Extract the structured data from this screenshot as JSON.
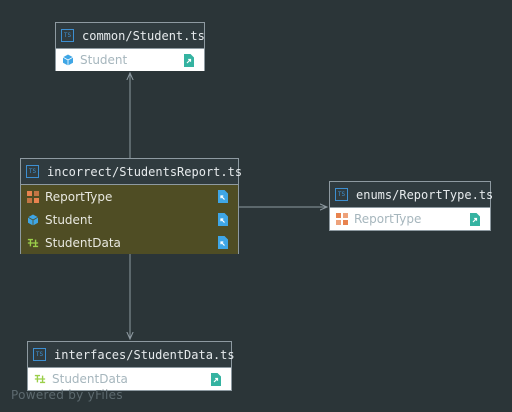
{
  "nodes": {
    "common_student": {
      "title": "common/Student.ts",
      "items": [
        {
          "label": "Student",
          "icon": "cube-icon"
        }
      ]
    },
    "incorrect_students_report": {
      "title": "incorrect/StudentsReport.ts",
      "items": [
        {
          "label": "ReportType",
          "icon": "enum-icon"
        },
        {
          "label": "Student",
          "icon": "cube-icon"
        },
        {
          "label": "StudentData",
          "icon": "interface-icon"
        }
      ]
    },
    "enums_report_type": {
      "title": "enums/ReportType.ts",
      "items": [
        {
          "label": "ReportType",
          "icon": "enum-icon"
        }
      ]
    },
    "interfaces_student_data": {
      "title": "interfaces/StudentData.ts",
      "items": [
        {
          "label": "StudentData",
          "icon": "interface-icon"
        }
      ]
    }
  },
  "ts_badge": "TS",
  "watermark": "Powered by yFiles",
  "colors": {
    "background": "#2b3538",
    "header": "#303b3f",
    "highlight_body": "#4f4d24",
    "edge": "#8e9aa1",
    "ts_blue": "#3d8fd1",
    "enum_orange": "#e8834f",
    "class_blue": "#3fa6e5",
    "interface_green": "#9bcf4a",
    "file_teal": "#35b3a1"
  }
}
